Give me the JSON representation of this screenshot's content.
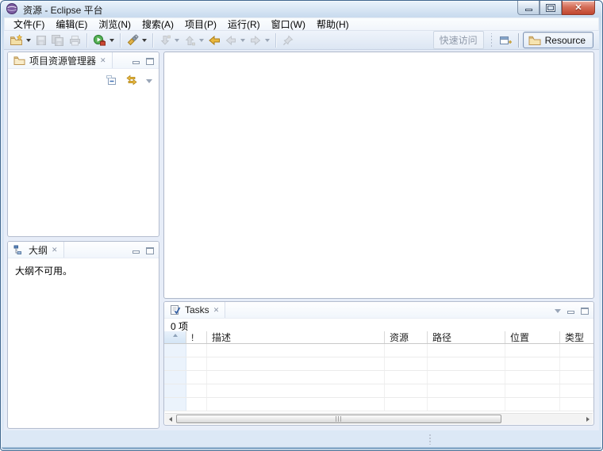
{
  "window": {
    "title": "资源 - Eclipse 平台"
  },
  "icons": {
    "tab_close": "✕",
    "window_close": "✕"
  },
  "menu_bar": {
    "items": [
      "文件(F)",
      "编辑(E)",
      "浏览(N)",
      "搜索(A)",
      "项目(P)",
      "运行(R)",
      "窗口(W)",
      "帮助(H)"
    ]
  },
  "toolbar": {
    "quick_access": "快速访问",
    "resource_button": "Resource"
  },
  "project_explorer": {
    "title": "项目资源管理器"
  },
  "outline": {
    "title": "大纲",
    "message": "大纲不可用。"
  },
  "tasks": {
    "title": "Tasks",
    "count": "0 项",
    "columns": [
      "",
      "!",
      "描述",
      "资源",
      "路径",
      "位置",
      "类型"
    ]
  }
}
